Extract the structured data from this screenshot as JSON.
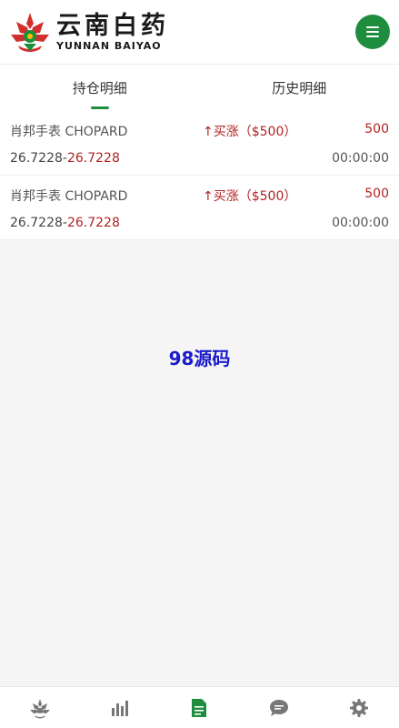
{
  "header": {
    "logo_cn": "云南白药",
    "logo_en": "YUNNAN BAIYAO",
    "brand_color": "#1e8e3e",
    "menu_icon": "hamburger-icon"
  },
  "tabs": [
    {
      "label": "持仓明细",
      "active": true
    },
    {
      "label": "历史明细",
      "active": false
    }
  ],
  "positions": [
    {
      "product": "肖邦手表 CHOPARD",
      "direction": "↑买涨",
      "stake": "（$500）",
      "amount": "500",
      "open_price": "26.7228",
      "separator": "-",
      "current_price": "26.7228",
      "countdown": "00:00:00"
    },
    {
      "product": "肖邦手表 CHOPARD",
      "direction": "↑买涨",
      "stake": "（$500）",
      "amount": "500",
      "open_price": "26.7228",
      "separator": "-",
      "current_price": "26.7228",
      "countdown": "00:00:00"
    }
  ],
  "watermark": "98源码",
  "bottom_nav": [
    {
      "icon": "lotus-icon",
      "active": false
    },
    {
      "icon": "bar-chart-icon",
      "active": false
    },
    {
      "icon": "document-icon",
      "active": true
    },
    {
      "icon": "chat-bubble-icon",
      "active": false
    },
    {
      "icon": "gear-icon",
      "active": false
    }
  ]
}
